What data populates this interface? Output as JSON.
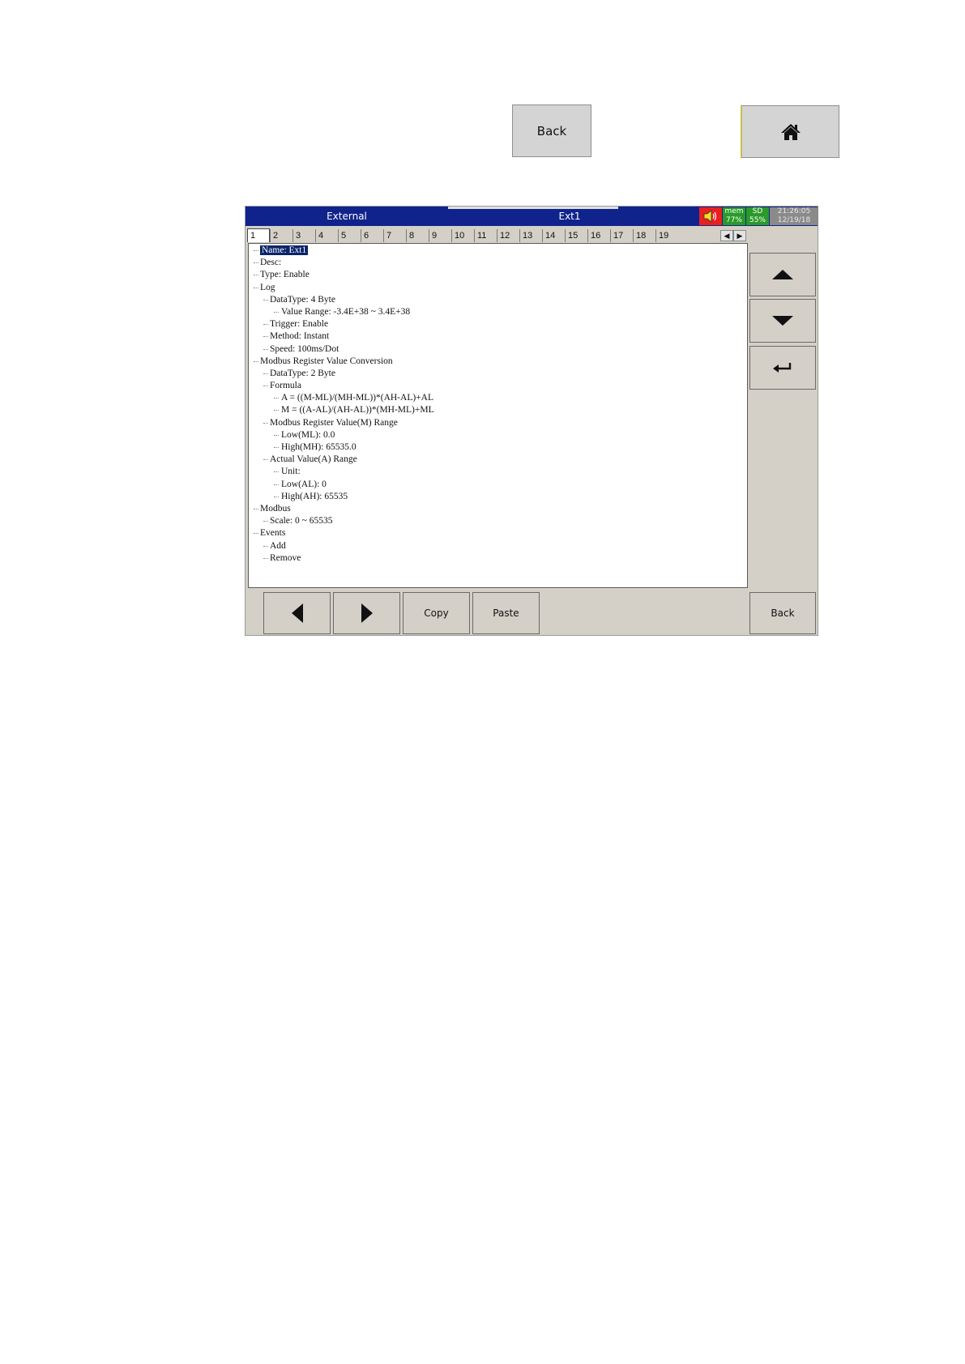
{
  "top_buttons": {
    "back_label": "Back"
  },
  "title_bar": {
    "left": "External",
    "right": "Ext1",
    "mem_label": "mem",
    "mem_value": "77%",
    "sd_label": "SD",
    "sd_value": "55%",
    "time": "21:26:05",
    "date": "12/19/18"
  },
  "tabs": [
    "1",
    "2",
    "3",
    "4",
    "5",
    "6",
    "7",
    "8",
    "9",
    "10",
    "11",
    "12",
    "13",
    "14",
    "15",
    "16",
    "17",
    "18",
    "19"
  ],
  "active_tab": "1",
  "tree": [
    {
      "level": 0,
      "text": "Name: Ext1",
      "selected": true
    },
    {
      "level": 0,
      "text": "Desc:"
    },
    {
      "level": 0,
      "text": "Type: Enable"
    },
    {
      "level": 0,
      "text": "Log"
    },
    {
      "level": 1,
      "text": "DataType: 4 Byte"
    },
    {
      "level": 2,
      "text": "Value Range: -3.4E+38  ~ 3.4E+38"
    },
    {
      "level": 1,
      "text": "Trigger: Enable"
    },
    {
      "level": 1,
      "text": "Method: Instant"
    },
    {
      "level": 1,
      "text": "Speed: 100ms/Dot"
    },
    {
      "level": 0,
      "text": "Modbus Register Value Conversion"
    },
    {
      "level": 1,
      "text": "DataType: 2 Byte"
    },
    {
      "level": 1,
      "text": "Formula"
    },
    {
      "level": 2,
      "text": "A = ((M-ML)/(MH-ML))*(AH-AL)+AL"
    },
    {
      "level": 2,
      "text": "M = ((A-AL)/(AH-AL))*(MH-ML)+ML"
    },
    {
      "level": 1,
      "text": "Modbus Register Value(M) Range"
    },
    {
      "level": 2,
      "text": "Low(ML): 0.0"
    },
    {
      "level": 2,
      "text": "High(MH): 65535.0"
    },
    {
      "level": 1,
      "text": "Actual Value(A) Range"
    },
    {
      "level": 2,
      "text": "Unit:"
    },
    {
      "level": 2,
      "text": "Low(AL): 0"
    },
    {
      "level": 2,
      "text": "High(AH): 65535"
    },
    {
      "level": 0,
      "text": "Modbus"
    },
    {
      "level": 1,
      "text": "Scale: 0 ~ 65535"
    },
    {
      "level": 0,
      "text": "Events"
    },
    {
      "level": 1,
      "text": "Add"
    },
    {
      "level": 1,
      "text": "Remove"
    }
  ],
  "bottom_buttons": {
    "copy": "Copy",
    "paste": "Paste",
    "back": "Back"
  },
  "icons": {
    "home": "home-icon",
    "speaker": "speaker-icon",
    "up": "arrow-up-icon",
    "down": "arrow-down-icon",
    "enter": "enter-icon",
    "left": "arrow-left-icon",
    "right": "arrow-right-icon"
  },
  "colors": {
    "title_bar": "#10238c",
    "speaker_bg": "#e82020",
    "status_green": "#2a9a2a",
    "selection": "#0a246a"
  }
}
